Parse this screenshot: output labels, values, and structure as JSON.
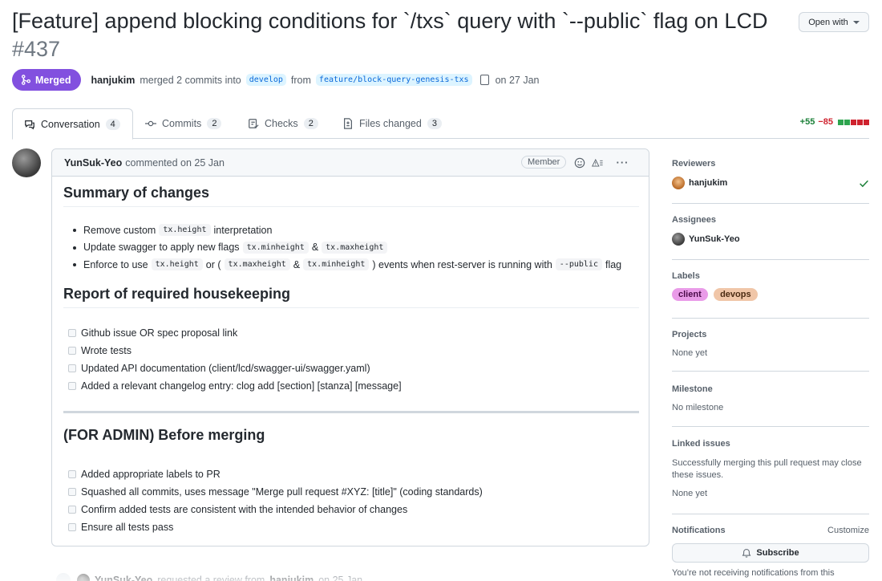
{
  "title": {
    "text": "[Feature] append blocking conditions for `/txs` query with `--public` flag on LCD",
    "number": "#437"
  },
  "open_with": {
    "label": "Open with"
  },
  "meta": {
    "status": "Merged",
    "author": "hanjukim",
    "action": "merged 2 commits into",
    "base_branch": "develop",
    "from_word": "from",
    "head_branch": "feature/block-query-genesis-txs",
    "date": "on 27 Jan"
  },
  "tabs": [
    {
      "label": "Conversation",
      "count": "4",
      "icon": "comment-discussion-icon"
    },
    {
      "label": "Commits",
      "count": "2",
      "icon": "commit-icon"
    },
    {
      "label": "Checks",
      "count": "2",
      "icon": "checklist-icon"
    },
    {
      "label": "Files changed",
      "count": "3",
      "icon": "file-diff-icon"
    }
  ],
  "diffstat": {
    "additions": "+55",
    "deletions": "−85",
    "add_color": "#2da44e",
    "del_color": "#cf222e",
    "neutral_color": "#d0d7de"
  },
  "comment": {
    "author": "YunSuk-Yeo",
    "meta": "commented on 25 Jan",
    "role": "Member",
    "sections": {
      "summary_title": "Summary of changes",
      "summary_items": [
        {
          "a": "Remove custom",
          "c1": "tx.height",
          "b": "interpretation"
        },
        {
          "a": "Update swagger to apply new flags",
          "c1": "tx.minheight",
          "amp": "&",
          "c2": "tx.maxheight"
        },
        {
          "a": "Enforce to use",
          "c1": "tx.height",
          "or": "or (",
          "c2": "tx.maxheight",
          "amp": "&",
          "c3": "tx.minheight",
          "b": ") events when rest-server is running with",
          "c4": "--public",
          "flag": "flag"
        }
      ],
      "housekeeping_title": "Report of required housekeeping",
      "housekeeping_items": [
        "Github issue OR spec proposal link",
        "Wrote tests",
        "Updated API documentation (client/lcd/swagger-ui/swagger.yaml)",
        "Added a relevant changelog entry: clog add [section] [stanza] [message]"
      ],
      "admin_title": "(FOR ADMIN) Before merging",
      "admin_items": [
        "Added appropriate labels to PR",
        "Squashed all commits, uses message \"Merge pull request #XYZ: [title]\" (coding standards)",
        "Confirm added tests are consistent with the intended behavior of changes",
        "Ensure all tests pass"
      ]
    }
  },
  "timeline": {
    "actor": "YunSuk-Yeo",
    "action": "requested a review from",
    "target": "hanjukim",
    "date": "on 25 Jan"
  },
  "sidebar": {
    "reviewers": {
      "title": "Reviewers",
      "name": "hanjukim"
    },
    "assignees": {
      "title": "Assignees",
      "name": "YunSuk-Yeo"
    },
    "labels": {
      "title": "Labels",
      "items": [
        {
          "name": "client",
          "bg": "#e99be8",
          "fg": "#4a0a49"
        },
        {
          "name": "devops",
          "bg": "#f0c6a8",
          "fg": "#4a2a12"
        }
      ]
    },
    "projects": {
      "title": "Projects",
      "value": "None yet"
    },
    "milestone": {
      "title": "Milestone",
      "value": "No milestone"
    },
    "linked_issues": {
      "title": "Linked issues",
      "description": "Successfully merging this pull request may close these issues.",
      "value": "None yet"
    },
    "notifications": {
      "title": "Notifications",
      "customize": "Customize",
      "subscribe": "Subscribe",
      "note": "You’re not receiving notifications from this"
    }
  },
  "colors": {
    "merged": "#8250df",
    "accent": "#0969da"
  }
}
